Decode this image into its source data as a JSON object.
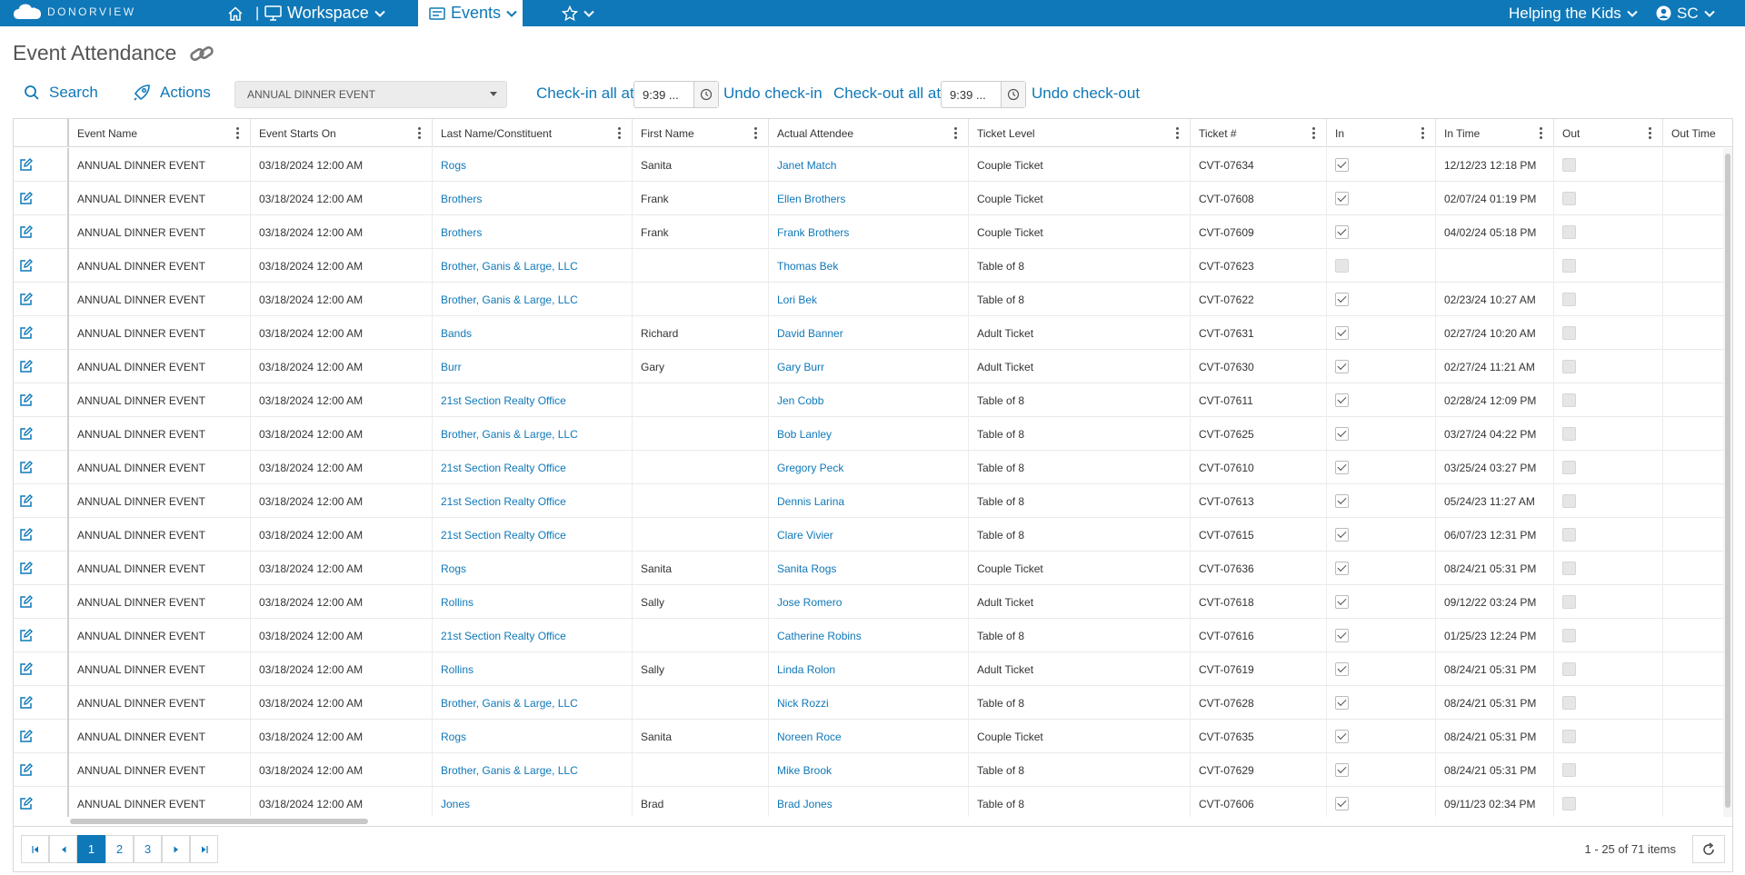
{
  "topbar": {
    "brand": "DONORVIEW",
    "home_divider": "|",
    "workspace_label": "Workspace",
    "events_label": "Events",
    "org_label": "Helping the Kids",
    "user_label": "SC"
  },
  "page": {
    "title": "Event Attendance"
  },
  "toolbar": {
    "search_label": "Search",
    "actions_label": "Actions",
    "event_select_value": "ANNUAL DINNER EVENT",
    "checkin_all_label": "Check-in all at",
    "checkin_time": "9:39 ...",
    "undo_checkin_label": "Undo check-in",
    "checkout_all_label": "Check-out all at",
    "checkout_time": "9:39 ...",
    "undo_checkout_label": "Undo check-out"
  },
  "grid": {
    "columns": [
      "Event Name",
      "Event Starts On",
      "Last Name/Constituent",
      "First Name",
      "Actual Attendee",
      "Ticket Level",
      "Ticket #",
      "In",
      "In Time",
      "Out",
      "Out Time"
    ],
    "rows": [
      {
        "event": "ANNUAL DINNER EVENT",
        "starts": "03/18/2024 12:00 AM",
        "last": "Rogs",
        "first": "Sanita",
        "attendee": "Janet Match",
        "level": "Couple Ticket",
        "ticket": "CVT-07634",
        "in": true,
        "in_time": "12/12/23 12:18 PM"
      },
      {
        "event": "ANNUAL DINNER EVENT",
        "starts": "03/18/2024 12:00 AM",
        "last": "Brothers",
        "first": "Frank",
        "attendee": "Ellen Brothers",
        "level": "Couple Ticket",
        "ticket": "CVT-07608",
        "in": true,
        "in_time": "02/07/24 01:19 PM"
      },
      {
        "event": "ANNUAL DINNER EVENT",
        "starts": "03/18/2024 12:00 AM",
        "last": "Brothers",
        "first": "Frank",
        "attendee": "Frank Brothers",
        "level": "Couple Ticket",
        "ticket": "CVT-07609",
        "in": true,
        "in_time": "04/02/24 05:18 PM"
      },
      {
        "event": "ANNUAL DINNER EVENT",
        "starts": "03/18/2024 12:00 AM",
        "last": "Brother, Ganis & Large, LLC",
        "first": "",
        "attendee": "Thomas Bek",
        "level": "Table of 8",
        "ticket": "CVT-07623",
        "in": false,
        "in_time": ""
      },
      {
        "event": "ANNUAL DINNER EVENT",
        "starts": "03/18/2024 12:00 AM",
        "last": "Brother, Ganis & Large, LLC",
        "first": "",
        "attendee": "Lori Bek",
        "level": "Table of 8",
        "ticket": "CVT-07622",
        "in": true,
        "in_time": "02/23/24 10:27 AM"
      },
      {
        "event": "ANNUAL DINNER EVENT",
        "starts": "03/18/2024 12:00 AM",
        "last": "Bands",
        "first": "Richard",
        "attendee": "David Banner",
        "level": "Adult Ticket",
        "ticket": "CVT-07631",
        "in": true,
        "in_time": "02/27/24 10:20 AM"
      },
      {
        "event": "ANNUAL DINNER EVENT",
        "starts": "03/18/2024 12:00 AM",
        "last": "Burr",
        "first": "Gary",
        "attendee": "Gary Burr",
        "level": "Adult Ticket",
        "ticket": "CVT-07630",
        "in": true,
        "in_time": "02/27/24 11:21 AM"
      },
      {
        "event": "ANNUAL DINNER EVENT",
        "starts": "03/18/2024 12:00 AM",
        "last": "21st Section Realty Office",
        "first": "",
        "attendee": "Jen Cobb",
        "level": "Table of 8",
        "ticket": "CVT-07611",
        "in": true,
        "in_time": "02/28/24 12:09 PM"
      },
      {
        "event": "ANNUAL DINNER EVENT",
        "starts": "03/18/2024 12:00 AM",
        "last": "Brother, Ganis & Large, LLC",
        "first": "",
        "attendee": "Bob Lanley",
        "level": "Table of 8",
        "ticket": "CVT-07625",
        "in": true,
        "in_time": "03/27/24 04:22 PM"
      },
      {
        "event": "ANNUAL DINNER EVENT",
        "starts": "03/18/2024 12:00 AM",
        "last": "21st Section Realty Office",
        "first": "",
        "attendee": "Gregory Peck",
        "level": "Table of 8",
        "ticket": "CVT-07610",
        "in": true,
        "in_time": "03/25/24 03:27 PM"
      },
      {
        "event": "ANNUAL DINNER EVENT",
        "starts": "03/18/2024 12:00 AM",
        "last": "21st Section Realty Office",
        "first": "",
        "attendee": "Dennis Larina",
        "level": "Table of 8",
        "ticket": "CVT-07613",
        "in": true,
        "in_time": "05/24/23 11:27 AM"
      },
      {
        "event": "ANNUAL DINNER EVENT",
        "starts": "03/18/2024 12:00 AM",
        "last": "21st Section Realty Office",
        "first": "",
        "attendee": "Clare Vivier",
        "level": "Table of 8",
        "ticket": "CVT-07615",
        "in": true,
        "in_time": "06/07/23 12:31 PM"
      },
      {
        "event": "ANNUAL DINNER EVENT",
        "starts": "03/18/2024 12:00 AM",
        "last": "Rogs",
        "first": "Sanita",
        "attendee": "Sanita Rogs",
        "level": "Couple Ticket",
        "ticket": "CVT-07636",
        "in": true,
        "in_time": "08/24/21 05:31 PM"
      },
      {
        "event": "ANNUAL DINNER EVENT",
        "starts": "03/18/2024 12:00 AM",
        "last": "Rollins",
        "first": "Sally",
        "attendee": "Jose Romero",
        "level": "Adult Ticket",
        "ticket": "CVT-07618",
        "in": true,
        "in_time": "09/12/22 03:24 PM"
      },
      {
        "event": "ANNUAL DINNER EVENT",
        "starts": "03/18/2024 12:00 AM",
        "last": "21st Section Realty Office",
        "first": "",
        "attendee": "Catherine Robins",
        "level": "Table of 8",
        "ticket": "CVT-07616",
        "in": true,
        "in_time": "01/25/23 12:24 PM"
      },
      {
        "event": "ANNUAL DINNER EVENT",
        "starts": "03/18/2024 12:00 AM",
        "last": "Rollins",
        "first": "Sally",
        "attendee": "Linda Rolon",
        "level": "Adult Ticket",
        "ticket": "CVT-07619",
        "in": true,
        "in_time": "08/24/21 05:31 PM"
      },
      {
        "event": "ANNUAL DINNER EVENT",
        "starts": "03/18/2024 12:00 AM",
        "last": "Brother, Ganis & Large, LLC",
        "first": "",
        "attendee": "Nick Rozzi",
        "level": "Table of 8",
        "ticket": "CVT-07628",
        "in": true,
        "in_time": "08/24/21 05:31 PM"
      },
      {
        "event": "ANNUAL DINNER EVENT",
        "starts": "03/18/2024 12:00 AM",
        "last": "Rogs",
        "first": "Sanita",
        "attendee": "Noreen Roce",
        "level": "Couple Ticket",
        "ticket": "CVT-07635",
        "in": true,
        "in_time": "08/24/21 05:31 PM"
      },
      {
        "event": "ANNUAL DINNER EVENT",
        "starts": "03/18/2024 12:00 AM",
        "last": "Brother, Ganis & Large, LLC",
        "first": "",
        "attendee": "Mike Brook",
        "level": "Table of 8",
        "ticket": "CVT-07629",
        "in": true,
        "in_time": "08/24/21 05:31 PM"
      },
      {
        "event": "ANNUAL DINNER EVENT",
        "starts": "03/18/2024 12:00 AM",
        "last": "Jones",
        "first": "Brad",
        "attendee": "Brad Jones",
        "level": "Table of 8",
        "ticket": "CVT-07606",
        "in": true,
        "in_time": "09/11/23 02:34 PM"
      }
    ]
  },
  "pager": {
    "pages": [
      "1",
      "2",
      "3"
    ],
    "active_page": "1",
    "info": "1 - 25 of 71 items"
  },
  "colors": {
    "brand": "#0f78b8",
    "header_bg": "#0f78b8"
  }
}
